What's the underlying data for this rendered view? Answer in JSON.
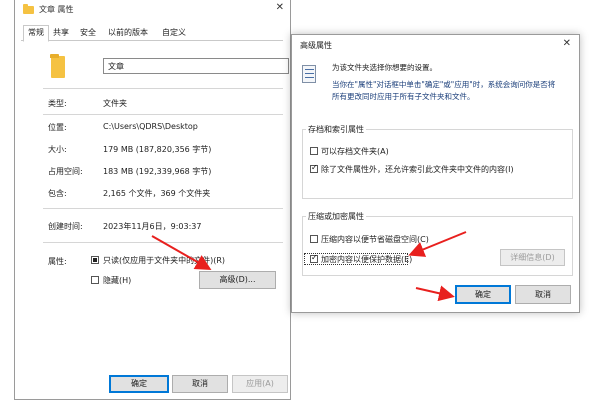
{
  "props_window": {
    "title": "文章 属性",
    "tabs": [
      "常规",
      "共享",
      "安全",
      "以前的版本",
      "自定义"
    ],
    "folder_name": "文章",
    "rows": [
      {
        "label": "类型:",
        "value": "文件夹"
      },
      {
        "label": "位置:",
        "value": "C:\\Users\\QDRS\\Desktop"
      },
      {
        "label": "大小:",
        "value": "179 MB (187,820,356 字节)"
      },
      {
        "label": "占用空间:",
        "value": "183 MB (192,339,968 字节)"
      },
      {
        "label": "包含:",
        "value": "2,165 个文件，369 个文件夹"
      },
      {
        "label": "创建时间:",
        "value": "2023年11月6日，9:03:37"
      },
      {
        "label": "属性:",
        "value": ""
      }
    ],
    "readonly_label": "只读(仅应用于文件夹中的文件)(R)",
    "hidden_label": "隐藏(H)",
    "advanced_button": "高级(D)...",
    "ok_button": "确定",
    "cancel_button": "取消",
    "apply_button": "应用(A)"
  },
  "advanced_dialog": {
    "title": "高级属性",
    "desc_line1": "为该文件夹选择你想要的设置。",
    "desc_line2": "当你在\"属性\"对话框中单击\"确定\"或\"应用\"时，系统会询问你是否将",
    "desc_line3": "所有更改同时应用于所有子文件夹和文件。",
    "archive_group_title": "存档和索引属性",
    "archive_label": "可以存档文件夹(A)",
    "index_label": "除了文件属性外，还允许索引此文件夹中文件的内容(I)",
    "compress_group_title": "压缩或加密属性",
    "compress_label": "压缩内容以便节省磁盘空间(C)",
    "encrypt_label": "加密内容以便保护数据(E)",
    "details_button": "详细信息(D)",
    "ok_button": "确定",
    "cancel_button": "取消",
    "close_glyph": "✕"
  },
  "colors": {
    "folder": "#f5c242",
    "focus_blue": "#0078d7",
    "annotation_red": "#e8201e"
  }
}
